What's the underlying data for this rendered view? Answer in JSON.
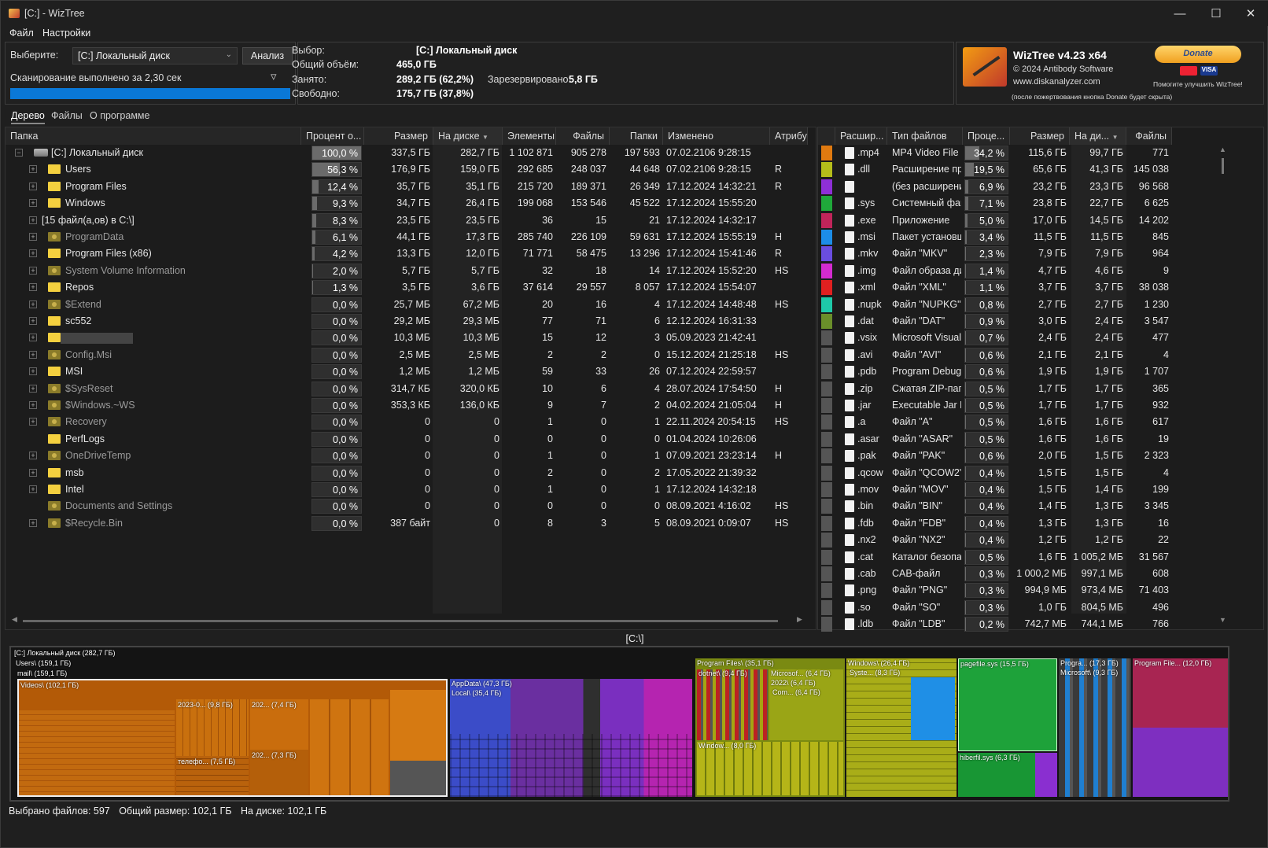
{
  "window": {
    "title": "[C:]  - WizTree"
  },
  "menu": {
    "file": "Файл",
    "settings": "Настройки"
  },
  "select_pane": {
    "label": "Выберите:",
    "drive": "[C:] Локальный диск",
    "analyze": "Анализ",
    "scan_status": "Сканирование выполнено за 2,30 сек",
    "progress": 1.0
  },
  "info": {
    "selection_label": "Выбор:",
    "selection_value": "[C:]  Локальный диск",
    "total_label": "Общий объём:",
    "total_value": "465,0 ГБ",
    "used_label": "Занято:",
    "used_value": "289,2 ГБ  (62,2%)",
    "reserved_label": "Зарезервировано:",
    "reserved_value": "5,8 ГБ",
    "free_label": "Свободно:",
    "free_value": "175,7 ГБ  (37,8%)"
  },
  "about": {
    "product": "WizTree v4.23 x64",
    "copyright": "© 2024 Antibody Software",
    "site": "www.diskanalyzer.com",
    "donate_button": "Donate",
    "donate_help": "Помогите улучшить WizTree!",
    "donate_note": "(после пожертвования кнопка Donate будет скрыта)"
  },
  "tabs": [
    "Дерево",
    "Файлы",
    "О программе"
  ],
  "tree": {
    "columns": [
      "Папка",
      "Процент о...",
      "Размер",
      "На диске",
      "Элементы",
      "Файлы",
      "Папки",
      "Изменено",
      "Атрибу"
    ],
    "rows": [
      {
        "name": "[C:] Локальный диск",
        "kind": "drive",
        "pct": "100,0 %",
        "pctv": 100,
        "size": "337,5 ГБ",
        "disk": "282,7 ГБ",
        "items": "1 102 871",
        "files": "905 278",
        "folders": "197 593",
        "modified": "07.02.2106 9:28:15",
        "attr": ""
      },
      {
        "name": "Users",
        "kind": "folder",
        "pct": "56,3 %",
        "pctv": 56.3,
        "size": "176,9 ГБ",
        "disk": "159,0 ГБ",
        "items": "292 685",
        "files": "248 037",
        "folders": "44 648",
        "modified": "07.02.2106 9:28:15",
        "attr": "R"
      },
      {
        "name": "Program Files",
        "kind": "folder",
        "pct": "12,4 %",
        "pctv": 12.4,
        "size": "35,7 ГБ",
        "disk": "35,1 ГБ",
        "items": "215 720",
        "files": "189 371",
        "folders": "26 349",
        "modified": "17.12.2024 14:32:21",
        "attr": "R"
      },
      {
        "name": "Windows",
        "kind": "folder",
        "pct": "9,3 %",
        "pctv": 9.3,
        "size": "34,7 ГБ",
        "disk": "26,4 ГБ",
        "items": "199 068",
        "files": "153 546",
        "folders": "45 522",
        "modified": "17.12.2024 15:55:20",
        "attr": ""
      },
      {
        "name": "[15 файл(а,ов) в C:\\]",
        "kind": "files",
        "pct": "8,3 %",
        "pctv": 8.3,
        "size": "23,5 ГБ",
        "disk": "23,5 ГБ",
        "items": "36",
        "files": "15",
        "folders": "21",
        "modified": "17.12.2024 14:32:17",
        "attr": ""
      },
      {
        "name": "ProgramData",
        "kind": "hidden",
        "pct": "6,1 %",
        "pctv": 6.1,
        "size": "44,1 ГБ",
        "disk": "17,3 ГБ",
        "items": "285 740",
        "files": "226 109",
        "folders": "59 631",
        "modified": "17.12.2024 15:55:19",
        "attr": "H"
      },
      {
        "name": "Program Files (x86)",
        "kind": "folder",
        "pct": "4,2 %",
        "pctv": 4.2,
        "size": "13,3 ГБ",
        "disk": "12,0 ГБ",
        "items": "71 771",
        "files": "58 475",
        "folders": "13 296",
        "modified": "17.12.2024 15:41:46",
        "attr": "R"
      },
      {
        "name": "System Volume Information",
        "kind": "system",
        "pct": "2,0 %",
        "pctv": 2.0,
        "size": "5,7 ГБ",
        "disk": "5,7 ГБ",
        "items": "32",
        "files": "18",
        "folders": "14",
        "modified": "17.12.2024 15:52:20",
        "attr": "HS"
      },
      {
        "name": "Repos",
        "kind": "folder",
        "pct": "1,3 %",
        "pctv": 1.3,
        "size": "3,5 ГБ",
        "disk": "3,6 ГБ",
        "items": "37 614",
        "files": "29 557",
        "folders": "8 057",
        "modified": "17.12.2024 15:54:07",
        "attr": ""
      },
      {
        "name": "$Extend",
        "kind": "system",
        "pct": "0,0 %",
        "pctv": 0,
        "size": "25,7 МБ",
        "disk": "67,2 МБ",
        "items": "20",
        "files": "16",
        "folders": "4",
        "modified": "17.12.2024 14:48:48",
        "attr": "HS"
      },
      {
        "name": "sc552",
        "kind": "folder",
        "pct": "0,0 %",
        "pctv": 0,
        "size": "29,2 МБ",
        "disk": "29,3 МБ",
        "items": "77",
        "files": "71",
        "folders": "6",
        "modified": "12.12.2024 16:31:33",
        "attr": ""
      },
      {
        "name": "",
        "kind": "blurred",
        "pct": "0,0 %",
        "pctv": 0,
        "size": "10,3 МБ",
        "disk": "10,3 МБ",
        "items": "15",
        "files": "12",
        "folders": "3",
        "modified": "05.09.2023 21:42:41",
        "attr": ""
      },
      {
        "name": "Config.Msi",
        "kind": "system",
        "pct": "0,0 %",
        "pctv": 0,
        "size": "2,5 МБ",
        "disk": "2,5 МБ",
        "items": "2",
        "files": "2",
        "folders": "0",
        "modified": "15.12.2024 21:25:18",
        "attr": "HS"
      },
      {
        "name": "MSI",
        "kind": "folder",
        "pct": "0,0 %",
        "pctv": 0,
        "size": "1,2 МБ",
        "disk": "1,2 МБ",
        "items": "59",
        "files": "33",
        "folders": "26",
        "modified": "07.12.2024 22:59:57",
        "attr": ""
      },
      {
        "name": "$SysReset",
        "kind": "hidden",
        "pct": "0,0 %",
        "pctv": 0,
        "size": "314,7 КБ",
        "disk": "320,0 КБ",
        "items": "10",
        "files": "6",
        "folders": "4",
        "modified": "28.07.2024 17:54:50",
        "attr": "H"
      },
      {
        "name": "$Windows.~WS",
        "kind": "hidden",
        "pct": "0,0 %",
        "pctv": 0,
        "size": "353,3 КБ",
        "disk": "136,0 КБ",
        "items": "9",
        "files": "7",
        "folders": "2",
        "modified": "04.02.2024 21:05:04",
        "attr": "H"
      },
      {
        "name": "Recovery",
        "kind": "system",
        "pct": "0,0 %",
        "pctv": 0,
        "size": "0",
        "disk": "0",
        "items": "1",
        "files": "0",
        "folders": "1",
        "modified": "22.11.2024 20:54:15",
        "attr": "HS"
      },
      {
        "name": "PerfLogs",
        "kind": "folder-noexp",
        "pct": "0,0 %",
        "pctv": 0,
        "size": "0",
        "disk": "0",
        "items": "0",
        "files": "0",
        "folders": "0",
        "modified": "01.04.2024 10:26:06",
        "attr": ""
      },
      {
        "name": "OneDriveTemp",
        "kind": "hidden",
        "pct": "0,0 %",
        "pctv": 0,
        "size": "0",
        "disk": "0",
        "items": "1",
        "files": "0",
        "folders": "1",
        "modified": "07.09.2021 23:23:14",
        "attr": "H"
      },
      {
        "name": "msb",
        "kind": "folder",
        "pct": "0,0 %",
        "pctv": 0,
        "size": "0",
        "disk": "0",
        "items": "2",
        "files": "0",
        "folders": "2",
        "modified": "17.05.2022 21:39:32",
        "attr": ""
      },
      {
        "name": "Intel",
        "kind": "folder",
        "pct": "0,0 %",
        "pctv": 0,
        "size": "0",
        "disk": "0",
        "items": "1",
        "files": "0",
        "folders": "1",
        "modified": "17.12.2024 14:32:18",
        "attr": ""
      },
      {
        "name": "Documents and Settings",
        "kind": "system-noexp",
        "pct": "0,0 %",
        "pctv": 0,
        "size": "0",
        "disk": "0",
        "items": "0",
        "files": "0",
        "folders": "0",
        "modified": "08.09.2021 4:16:02",
        "attr": "HS"
      },
      {
        "name": "$Recycle.Bin",
        "kind": "system",
        "pct": "0,0 %",
        "pctv": 0,
        "size": "387 байт",
        "disk": "0",
        "items": "8",
        "files": "3",
        "folders": "5",
        "modified": "08.09.2021 0:09:07",
        "attr": "HS"
      }
    ]
  },
  "extensions": {
    "columns": [
      "Расшир...",
      "Тип файлов",
      "Проце...",
      "Размер",
      "На ди...",
      "Файлы"
    ],
    "rows": [
      {
        "color": "#e07a10",
        "ext": ".mp4",
        "type": "MP4 Video File (",
        "pct": "34,2 %",
        "pctv": 34.2,
        "size": "115,6 ГБ",
        "disk": "99,7 ГБ",
        "files": "771"
      },
      {
        "color": "#b5bd1a",
        "ext": ".dll",
        "type": "Расширение пр",
        "pct": "19,5 %",
        "pctv": 19.5,
        "size": "65,6 ГБ",
        "disk": "41,3 ГБ",
        "files": "145 038"
      },
      {
        "color": "#8e2fd6",
        "ext": "",
        "type": "(без расширени",
        "pct": "6,9 %",
        "pctv": 6.9,
        "size": "23,2 ГБ",
        "disk": "23,3 ГБ",
        "files": "96 568"
      },
      {
        "color": "#1fa83a",
        "ext": ".sys",
        "type": "Системный фай",
        "pct": "7,1 %",
        "pctv": 7.1,
        "size": "23,8 ГБ",
        "disk": "22,7 ГБ",
        "files": "6 625"
      },
      {
        "color": "#c0245a",
        "ext": ".exe",
        "type": "Приложение",
        "pct": "5,0 %",
        "pctv": 5.0,
        "size": "17,0 ГБ",
        "disk": "14,5 ГБ",
        "files": "14 202"
      },
      {
        "color": "#1c8de8",
        "ext": ".msi",
        "type": "Пакет установщ",
        "pct": "3,4 %",
        "pctv": 3.4,
        "size": "11,5 ГБ",
        "disk": "11,5 ГБ",
        "files": "845"
      },
      {
        "color": "#6a4de0",
        "ext": ".mkv",
        "type": "Файл \"MKV\"",
        "pct": "2,3 %",
        "pctv": 2.3,
        "size": "7,9 ГБ",
        "disk": "7,9 ГБ",
        "files": "964"
      },
      {
        "color": "#d42bd0",
        "ext": ".img",
        "type": "Файл образа ди",
        "pct": "1,4 %",
        "pctv": 1.4,
        "size": "4,7 ГБ",
        "disk": "4,6 ГБ",
        "files": "9"
      },
      {
        "color": "#e02020",
        "ext": ".xml",
        "type": "Файл \"XML\"",
        "pct": "1,1 %",
        "pctv": 1.1,
        "size": "3,7 ГБ",
        "disk": "3,7 ГБ",
        "files": "38 038"
      },
      {
        "color": "#1ec9a8",
        "ext": ".nupk",
        "type": "Файл \"NUPKG\"",
        "pct": "0,8 %",
        "pctv": 0.8,
        "size": "2,7 ГБ",
        "disk": "2,7 ГБ",
        "files": "1 230"
      },
      {
        "color": "#6a8f2a",
        "ext": ".dat",
        "type": "Файл \"DAT\"",
        "pct": "0,9 %",
        "pctv": 0.9,
        "size": "3,0 ГБ",
        "disk": "2,4 ГБ",
        "files": "3 547"
      },
      {
        "color": "#555555",
        "ext": ".vsix",
        "type": "Microsoft Visual",
        "pct": "0,7 %",
        "pctv": 0.7,
        "size": "2,4 ГБ",
        "disk": "2,4 ГБ",
        "files": "477"
      },
      {
        "color": "#555555",
        "ext": ".avi",
        "type": "Файл \"AVI\"",
        "pct": "0,6 %",
        "pctv": 0.6,
        "size": "2,1 ГБ",
        "disk": "2,1 ГБ",
        "files": "4"
      },
      {
        "color": "#555555",
        "ext": ".pdb",
        "type": "Program Debug",
        "pct": "0,6 %",
        "pctv": 0.6,
        "size": "1,9 ГБ",
        "disk": "1,9 ГБ",
        "files": "1 707"
      },
      {
        "color": "#555555",
        "ext": ".zip",
        "type": "Сжатая ZIP-пап",
        "pct": "0,5 %",
        "pctv": 0.5,
        "size": "1,7 ГБ",
        "disk": "1,7 ГБ",
        "files": "365"
      },
      {
        "color": "#555555",
        "ext": ".jar",
        "type": "Executable Jar Fi",
        "pct": "0,5 %",
        "pctv": 0.5,
        "size": "1,7 ГБ",
        "disk": "1,7 ГБ",
        "files": "932"
      },
      {
        "color": "#555555",
        "ext": ".a",
        "type": "Файл \"A\"",
        "pct": "0,5 %",
        "pctv": 0.5,
        "size": "1,6 ГБ",
        "disk": "1,6 ГБ",
        "files": "617"
      },
      {
        "color": "#555555",
        "ext": ".asar",
        "type": "Файл \"ASAR\"",
        "pct": "0,5 %",
        "pctv": 0.5,
        "size": "1,6 ГБ",
        "disk": "1,6 ГБ",
        "files": "19"
      },
      {
        "color": "#555555",
        "ext": ".pak",
        "type": "Файл \"PAK\"",
        "pct": "0,6 %",
        "pctv": 0.6,
        "size": "2,0 ГБ",
        "disk": "1,5 ГБ",
        "files": "2 323"
      },
      {
        "color": "#555555",
        "ext": ".qcow",
        "type": "Файл \"QCOW2\"",
        "pct": "0,4 %",
        "pctv": 0.4,
        "size": "1,5 ГБ",
        "disk": "1,5 ГБ",
        "files": "4"
      },
      {
        "color": "#555555",
        "ext": ".mov",
        "type": "Файл \"MOV\"",
        "pct": "0,4 %",
        "pctv": 0.4,
        "size": "1,5 ГБ",
        "disk": "1,4 ГБ",
        "files": "199"
      },
      {
        "color": "#555555",
        "ext": ".bin",
        "type": "Файл \"BIN\"",
        "pct": "0,4 %",
        "pctv": 0.4,
        "size": "1,4 ГБ",
        "disk": "1,3 ГБ",
        "files": "3 345"
      },
      {
        "color": "#555555",
        "ext": ".fdb",
        "type": "Файл \"FDB\"",
        "pct": "0,4 %",
        "pctv": 0.4,
        "size": "1,3 ГБ",
        "disk": "1,3 ГБ",
        "files": "16"
      },
      {
        "color": "#555555",
        "ext": ".nx2",
        "type": "Файл \"NX2\"",
        "pct": "0,4 %",
        "pctv": 0.4,
        "size": "1,2 ГБ",
        "disk": "1,2 ГБ",
        "files": "22"
      },
      {
        "color": "#555555",
        "ext": ".cat",
        "type": "Каталог безопа",
        "pct": "0,5 %",
        "pctv": 0.5,
        "size": "1,6 ГБ",
        "disk": "1 005,2 МБ",
        "files": "31 567"
      },
      {
        "color": "#555555",
        "ext": ".cab",
        "type": "CAB-файл",
        "pct": "0,3 %",
        "pctv": 0.3,
        "size": "1 000,2 МБ",
        "disk": "997,1 МБ",
        "files": "608"
      },
      {
        "color": "#555555",
        "ext": ".png",
        "type": "Файл \"PNG\"",
        "pct": "0,3 %",
        "pctv": 0.3,
        "size": "994,9 МБ",
        "disk": "973,4 МБ",
        "files": "71 403"
      },
      {
        "color": "#555555",
        "ext": ".so",
        "type": "Файл \"SO\"",
        "pct": "0,3 %",
        "pctv": 0.3,
        "size": "1,0 ГБ",
        "disk": "804,5 МБ",
        "files": "496"
      },
      {
        "color": "#555555",
        "ext": ".ldb",
        "type": "Файл \"LDB\"",
        "pct": "0,2 %",
        "pctv": 0.2,
        "size": "742,7 МБ",
        "disk": "744,1 МБ",
        "files": "766"
      }
    ]
  },
  "treemap": {
    "path": "[C:\\]",
    "labels": {
      "root": "[C:] Локальный диск (282,7 ГБ)",
      "users": "Users\\ (159,1 ГБ)",
      "mail": "mail\\ (159,1 ГБ)",
      "videos": "Videos\\ (102,1 ГБ)",
      "v2023": "2023-0... (9,8 ГБ)",
      "v202a": "202... (7,4 ГБ)",
      "tel": "телефо... (7,5 ГБ)",
      "v202b": "202... (7,3 ГБ)",
      "appdata": "AppData\\ (47,3 ГБ)",
      "local": "Local\\ (35,4 ГБ)",
      "pf": "Program Files\\ (35,1 ГБ)",
      "dotnet": "dotnet\\ (9,4 ГБ)",
      "microsoft": "Microsof... (6,4 ГБ)",
      "v2022": "2022\\ (6,4 ГБ)",
      "com": "Com... (6,4 ГБ)",
      "window8": "Window... (8,0 ГБ)",
      "windows": "Windows\\ (26,4 ГБ)",
      "system": "Syste... (8,3 ГБ)",
      "pagefile": "pagefile.sys (15,5 ГБ)",
      "hiberfil": "hiberfil.sys (6,3 ГБ)",
      "progra": "Progra... (17,3 ГБ)",
      "microsoft2": "Microsoft\\ (9,3 ГБ)",
      "pf86": "Program File... (12,0 ГБ)"
    }
  },
  "status": {
    "selected": "Выбрано файлов: 597",
    "total": "Общий размер: 102,1 ГБ",
    "ondisk": "На диске: 102,1 ГБ"
  }
}
